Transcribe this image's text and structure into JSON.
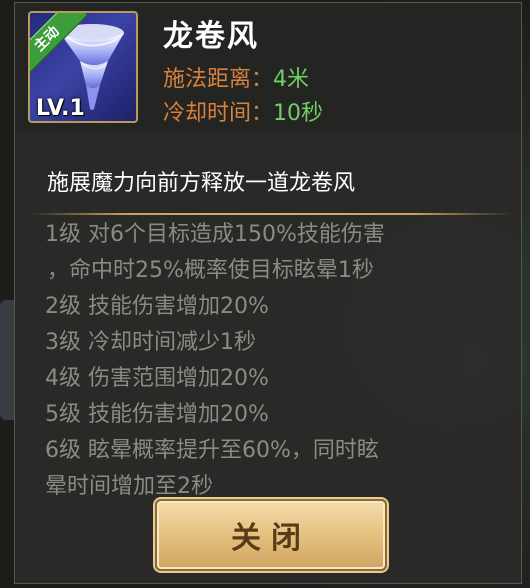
{
  "skill": {
    "name": "龙卷风",
    "badge": "主动",
    "level": "LV.1",
    "icon": "tornado-icon",
    "range_label": "施法距离：",
    "range_value": "4米",
    "cooldown_label": "冷却时间：",
    "cooldown_value": "10秒",
    "description": "施展魔力向前方释放一道龙卷风"
  },
  "levels": [
    "1级 对6个目标造成150%技能伤害",
    "，命中时25%概率使目标眩晕1秒",
    "2级 技能伤害增加20%",
    "3级 冷却时间减少1秒",
    "4级 伤害范围增加20%",
    "5级 技能伤害增加20%",
    "6级 眩晕概率提升至60%，同时眩",
    "晕时间增加至2秒"
  ],
  "close_label": "关闭",
  "colors": {
    "stat_label": "#d7813e",
    "stat_value": "#6fcf62",
    "button_bg": "#e3bf7c",
    "badge": "#3c9e3a"
  }
}
